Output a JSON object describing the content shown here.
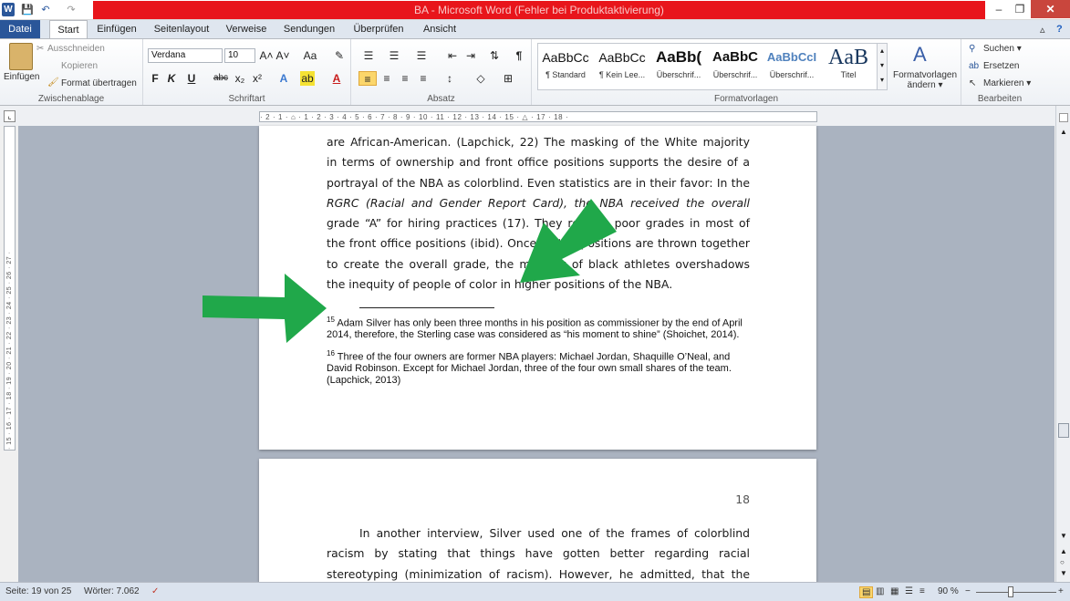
{
  "window": {
    "title": "BA  -  Microsoft Word (Fehler bei Produktaktivierung)",
    "minimize": "–",
    "restore": "❐",
    "close": "✕"
  },
  "qat": {
    "logo": "W",
    "save": "💾",
    "undo": "↶",
    "redo": "↷"
  },
  "tabs": {
    "file": "Datei",
    "items": [
      "Start",
      "Einfügen",
      "Seitenlayout",
      "Verweise",
      "Sendungen",
      "Überprüfen",
      "Ansicht"
    ],
    "help_up": "▵",
    "help": "?"
  },
  "ribbon": {
    "clipboard": {
      "paste": "Einfügen",
      "cut": "Ausschneiden",
      "copy": "Kopieren",
      "format": "Format übertragen",
      "label": "Zwischenablage"
    },
    "font": {
      "name": "Verdana",
      "size": "10",
      "label": "Schriftart",
      "buttons": [
        "F",
        "K",
        "U",
        "abc",
        "x₂",
        "x²"
      ],
      "grow": "A˄",
      "shrink": "A˅",
      "case": "Aa",
      "clear": "✎"
    },
    "paragraph": {
      "label": "Absatz",
      "pilcrow": "¶"
    },
    "styles": {
      "label": "Formatvorlagen",
      "items": [
        {
          "preview": "AaBbCc",
          "name": "¶ Standard"
        },
        {
          "preview": "AaBbCc",
          "name": "¶ Kein Lee..."
        },
        {
          "preview": "AaBb(",
          "name": "Überschrif..."
        },
        {
          "preview": "AaBbC",
          "name": "Überschrif..."
        },
        {
          "preview": "AaBbCcI",
          "name": "Überschrif..."
        },
        {
          "preview": "AaB",
          "name": "Titel"
        }
      ],
      "change": "Formatvorlagen ändern ▾"
    },
    "editing": {
      "find": "Suchen ▾",
      "replace": "Ersetzen",
      "select": "Markieren ▾",
      "label": "Bearbeiten"
    }
  },
  "ruler": {
    "h": "· 2 · 1 · ⌂ · 1 · 2 · 3 · 4 · 5 · 6 · 7 · 8 · 9 · 10 · 11 · 12 · 13 · 14 · 15 · △ · 17 · 18 ·",
    "v": "· 15 · 16 · 17 · 18 · 19 · 20 · 21 · 22 · 23 · 24 · 25 · 26 · 27 ·"
  },
  "page1": {
    "lines": [
      "are African-American. (Lapchick, 22) The masking of the White majority",
      "in terms of ownership and front office positions supports the desire of a",
      "portrayal of the NBA as colorblind. Even statistics are in their favor: In the",
      "RGRC (Racial and Gender Report Card), the NBA received the overall",
      "grade “A” for hiring practices (17). They receive poor grades in most of",
      "the front office positions (ibid). Once all the positions are thrown together",
      "to create the overall grade, the majority of black athletes overshadows",
      "the inequity of people of color in higher positions of the NBA."
    ],
    "fn15": {
      "num": "15",
      "text": " Adam Silver has only been three months in his position as commissioner by the end of April 2014, therefore, the Sterling case was considered as “his moment to shine” (Shoichet, 2014)."
    },
    "fn16": {
      "num": "16",
      "text": " Three of the four owners are former NBA players: Michael Jordan, Shaquille O’Neal, and David Robinson. Except for Michael Jordan, three of the four own small shares of the team. (Lapchick, 2013)"
    }
  },
  "page2": {
    "number": "18",
    "lines": [
      "In another interview, Silver used one of the frames of colorblind",
      "racism by stating that things have gotten better regarding racial",
      "stereotyping (minimization of racism). However, he admitted, that the"
    ]
  },
  "status": {
    "page": "Seite: 19 von 25",
    "words": "Wörter: 7.062",
    "zoom": "90 %",
    "minus": "−",
    "plus": "+"
  },
  "annotation_color": "#20a84a"
}
